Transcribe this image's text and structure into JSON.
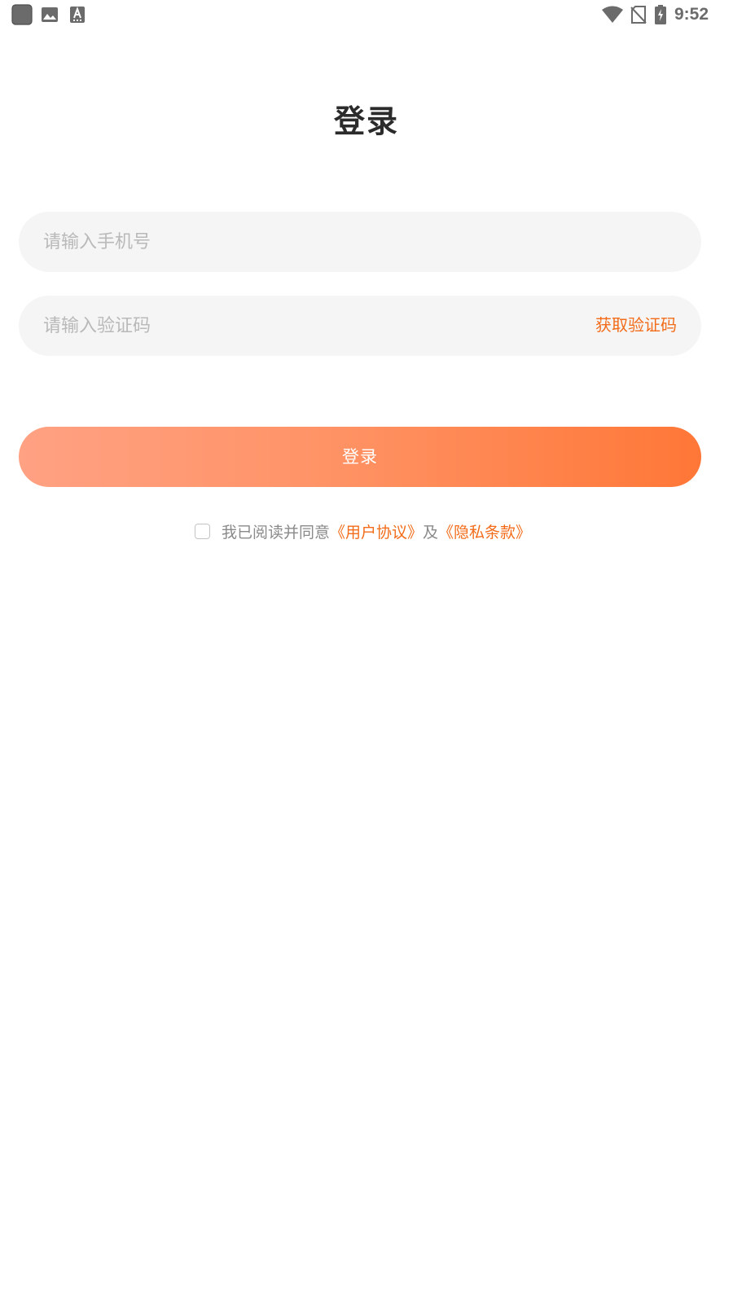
{
  "status_bar": {
    "time": "9:52",
    "left_icons": [
      "app-icon",
      "gallery-icon",
      "text-a-icon"
    ],
    "right_icons": [
      "wifi-icon",
      "no-sim-icon",
      "battery-charging-icon"
    ],
    "icon_color": "#6b6b6b"
  },
  "page": {
    "title": "登录"
  },
  "form": {
    "phone_placeholder": "请输入手机号",
    "phone_value": "",
    "code_placeholder": "请输入验证码",
    "code_value": "",
    "get_code_label": "获取验证码",
    "login_label": "登录"
  },
  "agreement": {
    "checked": false,
    "prefix": "我已阅读并同意",
    "user_agreement": "《用户协议》",
    "conjunction": "及",
    "privacy_terms": "《隐私条款》"
  },
  "colors": {
    "accent": "#f26c1a",
    "button_gradient_start": "#ffa183",
    "button_gradient_end": "#ff7737",
    "input_background": "#f5f5f5",
    "placeholder": "#b9b9b9",
    "title": "#2b2b2b"
  }
}
